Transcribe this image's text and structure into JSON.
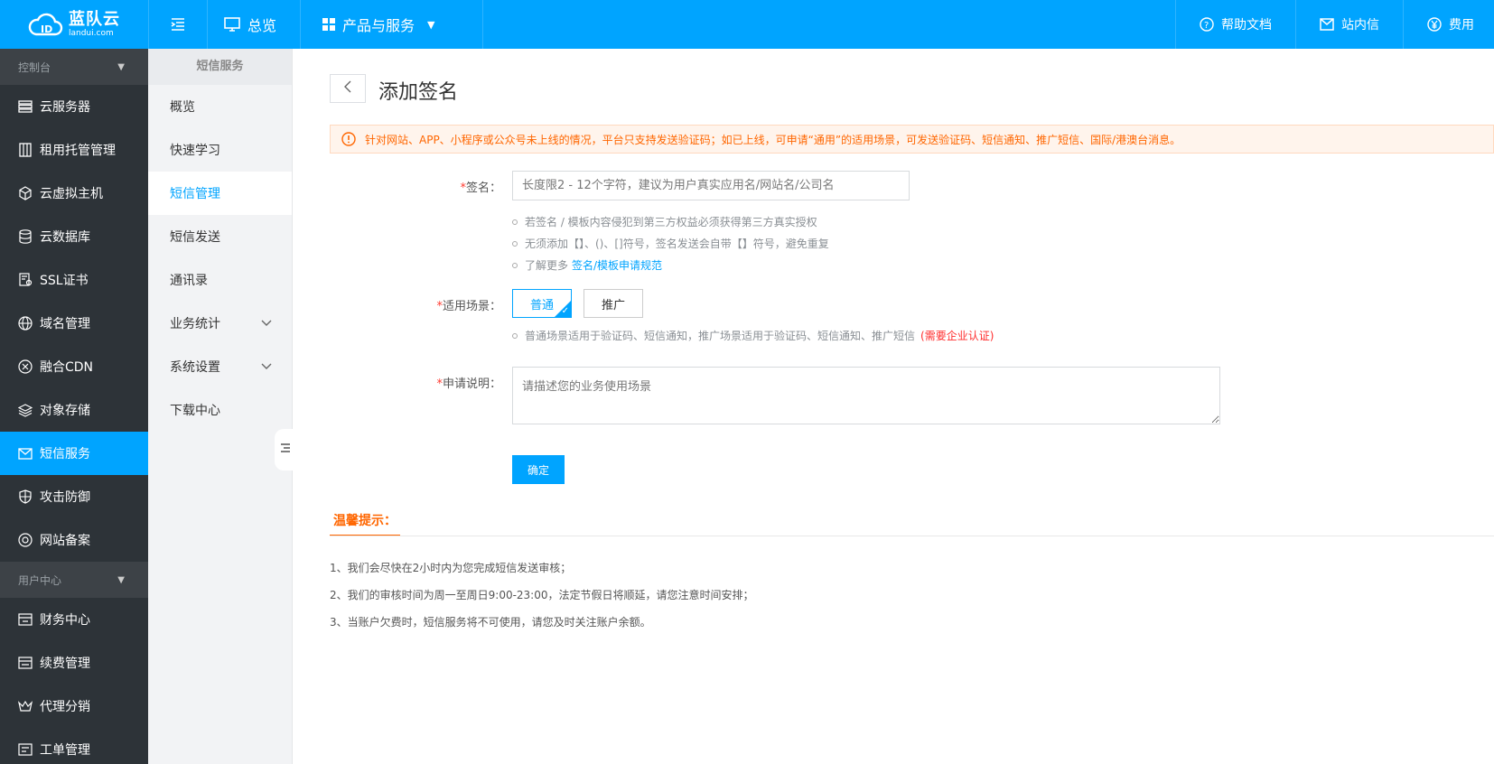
{
  "brand": {
    "name": "蓝队云",
    "sub": "landui.com"
  },
  "topbar": {
    "menu_toggle": "",
    "overview": "总览",
    "products": "产品与服务",
    "help": "帮助文档",
    "messages": "站内信",
    "billing": "费用"
  },
  "sidebar": {
    "group1": "控制台",
    "items": [
      {
        "label": "云服务器",
        "icon": "server-icon"
      },
      {
        "label": "租用托管管理",
        "icon": "rack-icon"
      },
      {
        "label": "云虚拟主机",
        "icon": "cube-icon"
      },
      {
        "label": "云数据库",
        "icon": "database-icon"
      },
      {
        "label": "SSL证书",
        "icon": "certificate-icon"
      },
      {
        "label": "域名管理",
        "icon": "globe-icon"
      },
      {
        "label": "融合CDN",
        "icon": "cdn-icon"
      },
      {
        "label": "对象存储",
        "icon": "layers-icon"
      },
      {
        "label": "短信服务",
        "icon": "mail-icon"
      },
      {
        "label": "攻击防御",
        "icon": "shield-icon"
      },
      {
        "label": "网站备案",
        "icon": "record-icon"
      }
    ],
    "group2": "用户中心",
    "items2": [
      {
        "label": "财务中心",
        "icon": "finance-icon"
      },
      {
        "label": "续费管理",
        "icon": "renew-icon"
      },
      {
        "label": "代理分销",
        "icon": "crown-icon"
      },
      {
        "label": "工单管理",
        "icon": "ticket-icon"
      }
    ]
  },
  "submenu": {
    "title": "短信服务",
    "items": [
      "概览",
      "快速学习",
      "短信管理",
      "短信发送",
      "通讯录",
      "业务统计",
      "系统设置",
      "下载中心"
    ]
  },
  "page": {
    "title": "添加签名",
    "notice": "针对网站、APP、小程序或公众号未上线的情况，平台只支持发送验证码；如已上线，可申请“通用”的适用场景，可发送验证码、短信通知、推广短信、国际/港澳台消息。",
    "signature_label": "签名：",
    "signature_placeholder": "长度限2 - 12个字符，建议为用户真实应用名/网站名/公司名",
    "hint1": "若签名 / 模板内容侵犯到第三方权益必须获得第三方真实授权",
    "hint2": "无须添加【】、()、[]符号，签名发送会自带【】符号，避免重复",
    "hint3_prefix": "了解更多",
    "hint3_link": "签名/模板申请规范",
    "scene_label": "适用场景：",
    "scene_options": [
      "普通",
      "推广"
    ],
    "scene_hint": "普通场景适用于验证码、短信通知，推广场景适用于验证码、短信通知、推广短信",
    "scene_hint_red": "(需要企业认证)",
    "desc_label": "申请说明：",
    "desc_placeholder": "请描述您的业务使用场景",
    "submit": "确定",
    "tips_title": "温馨提示：",
    "tips": [
      "1、我们会尽快在2小时内为您完成短信发送审核；",
      "2、我们的审核时间为周一至周日9:00-23:00，法定节假日将顺延，请您注意时间安排；",
      "3、当账户欠费时，短信服务将不可使用，请您及时关注账户余额。"
    ]
  },
  "colors": {
    "primary": "#00a4ff",
    "sidebar": "#2d3338",
    "warning": "#ff6600",
    "danger": "#ff2d2d"
  }
}
